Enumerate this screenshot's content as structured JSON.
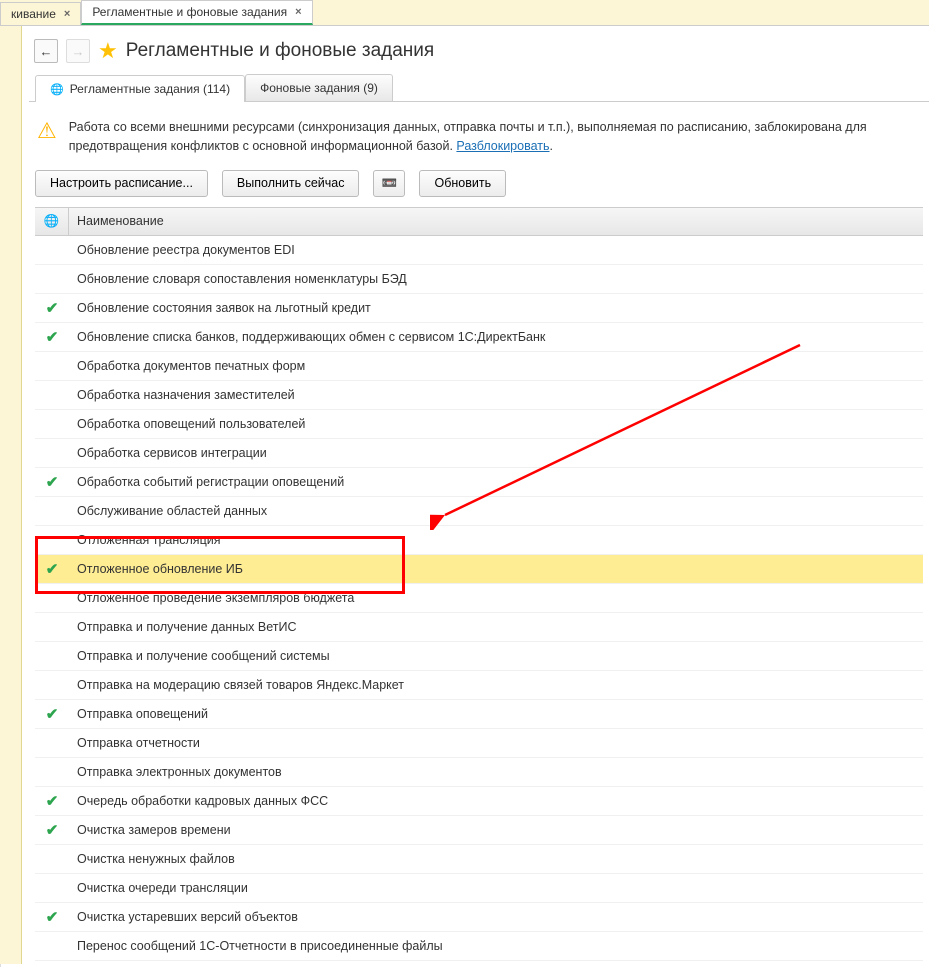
{
  "top_tabs": [
    {
      "label": "кивание",
      "active": false
    },
    {
      "label": "Регламентные и фоновые задания",
      "active": true
    }
  ],
  "header": {
    "title": "Регламентные и фоновые задания"
  },
  "main_tabs": [
    {
      "label": "Регламентные задания (114)",
      "active": true
    },
    {
      "label": "Фоновые задания (9)",
      "active": false
    }
  ],
  "warning": {
    "text": "Работа со всеми внешними ресурсами (синхронизация данных, отправка почты и т.п.), выполняемая по расписанию, заблокирована для предотвращения конфликтов с основной информационной базой. ",
    "link": "Разблокировать"
  },
  "toolbar": {
    "schedule": "Настроить расписание...",
    "run_now": "Выполнить сейчас",
    "refresh": "Обновить"
  },
  "table": {
    "header_name": "Наименование",
    "rows": [
      {
        "checked": false,
        "name": "Обновление реестра документов EDI"
      },
      {
        "checked": false,
        "name": "Обновление словаря сопоставления номенклатуры БЭД"
      },
      {
        "checked": true,
        "name": "Обновление состояния заявок на льготный кредит"
      },
      {
        "checked": true,
        "name": "Обновление списка банков, поддерживающих обмен с сервисом 1C:ДиректБанк"
      },
      {
        "checked": false,
        "name": "Обработка документов печатных форм"
      },
      {
        "checked": false,
        "name": "Обработка назначения заместителей"
      },
      {
        "checked": false,
        "name": "Обработка оповещений пользователей"
      },
      {
        "checked": false,
        "name": "Обработка сервисов интеграции"
      },
      {
        "checked": true,
        "name": "Обработка событий регистрации оповещений"
      },
      {
        "checked": false,
        "name": "Обслуживание областей данных"
      },
      {
        "checked": false,
        "name": "Отложенная трансляция"
      },
      {
        "checked": true,
        "name": "Отложенное обновление ИБ",
        "selected": true
      },
      {
        "checked": false,
        "name": "Отложенное проведение экземпляров бюджета"
      },
      {
        "checked": false,
        "name": "Отправка и получение данных ВетИС"
      },
      {
        "checked": false,
        "name": "Отправка и получение сообщений системы"
      },
      {
        "checked": false,
        "name": "Отправка на модерацию связей товаров Яндекс.Маркет"
      },
      {
        "checked": true,
        "name": "Отправка оповещений"
      },
      {
        "checked": false,
        "name": "Отправка отчетности"
      },
      {
        "checked": false,
        "name": "Отправка электронных документов"
      },
      {
        "checked": true,
        "name": "Очередь обработки кадровых данных ФСС"
      },
      {
        "checked": true,
        "name": "Очистка замеров времени"
      },
      {
        "checked": false,
        "name": "Очистка ненужных файлов"
      },
      {
        "checked": false,
        "name": "Очистка очереди трансляции"
      },
      {
        "checked": true,
        "name": "Очистка устаревших версий объектов"
      },
      {
        "checked": false,
        "name": "Перенос сообщений 1С-Отчетности в присоединенные файлы"
      }
    ]
  }
}
